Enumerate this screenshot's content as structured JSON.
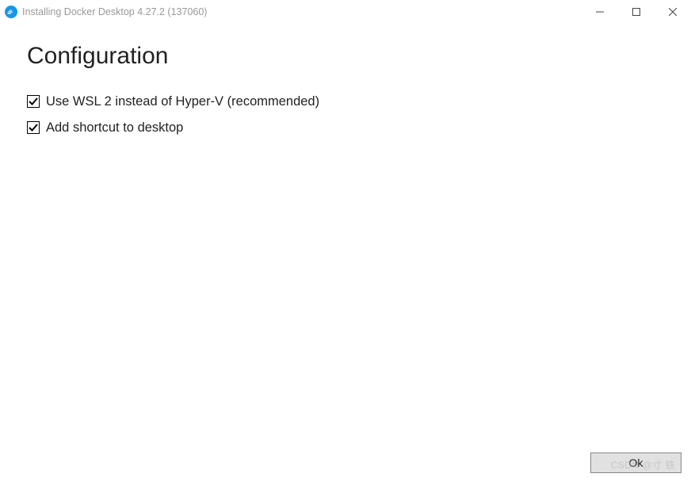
{
  "window": {
    "title": "Installing Docker Desktop 4.27.2 (137060)"
  },
  "page": {
    "heading": "Configuration"
  },
  "options": [
    {
      "label": "Use WSL 2 instead of Hyper-V (recommended)",
      "checked": true
    },
    {
      "label": "Add shortcut to desktop",
      "checked": true
    }
  ],
  "footer": {
    "ok_label": "Ok"
  },
  "watermark": "CSDN @寸 铁"
}
